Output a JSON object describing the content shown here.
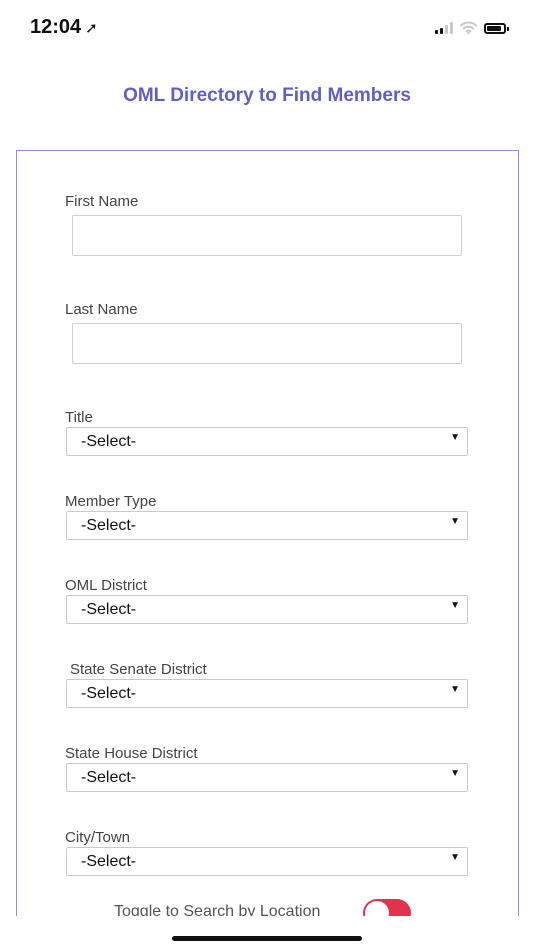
{
  "status_bar": {
    "time": "12:04",
    "location_glyph": "➚"
  },
  "header": {
    "title": "OML Directory to Find Members"
  },
  "form": {
    "first_name_label": "First Name",
    "first_name_value": "",
    "last_name_label": "Last Name",
    "last_name_value": "",
    "title_label": "Title",
    "title_value": "-Select-",
    "member_type_label": "Member Type",
    "member_type_value": "-Select-",
    "oml_district_label": "OML District",
    "oml_district_value": "-Select-",
    "state_senate_label": "State Senate District",
    "state_senate_value": "-Select-",
    "state_house_label": "State House District",
    "state_house_value": "-Select-",
    "city_label": "City/Town",
    "city_value": "-Select-",
    "toggle_label": "Toggle to Search by Location",
    "toggle_on": false
  },
  "colors": {
    "accent": "#5f5fc4",
    "card_border": "#8d8ddc",
    "toggle": "#e0344d"
  },
  "icons": {
    "signal": "signal-icon",
    "wifi": "wifi-icon",
    "battery": "battery-icon",
    "dropdown": "caret-down-icon"
  }
}
